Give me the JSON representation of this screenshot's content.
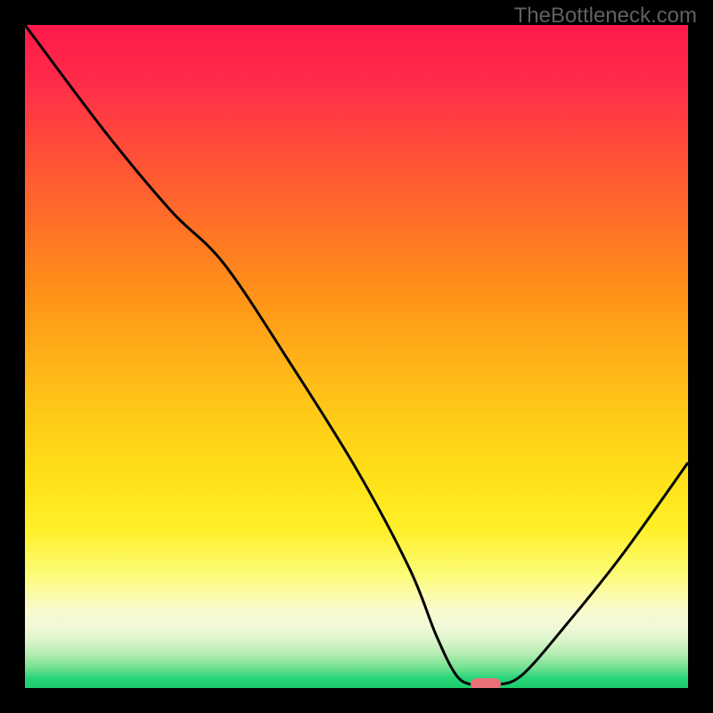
{
  "watermark": "TheBottleneck.com",
  "chart_data": {
    "type": "line",
    "title": "",
    "xlabel": "",
    "ylabel": "",
    "xlim": [
      0,
      100
    ],
    "ylim": [
      0,
      100
    ],
    "grid": false,
    "series": [
      {
        "name": "curve",
        "x": [
          0,
          12,
          22,
          30,
          40,
          50,
          58,
          62,
          65,
          67.5,
          71,
          75,
          82,
          90,
          100
        ],
        "y": [
          100,
          84,
          72,
          64,
          49,
          33,
          18,
          8,
          2,
          0.5,
          0.5,
          2,
          10,
          20,
          34
        ]
      }
    ],
    "marker": {
      "x": 69.5,
      "y": 0.5
    },
    "background_gradient": {
      "stops": [
        {
          "pos": 0,
          "color": "#ff1a4a"
        },
        {
          "pos": 50,
          "color": "#ffc818"
        },
        {
          "pos": 85,
          "color": "#fcfc78"
        },
        {
          "pos": 100,
          "color": "#1ecc6e"
        }
      ]
    }
  }
}
